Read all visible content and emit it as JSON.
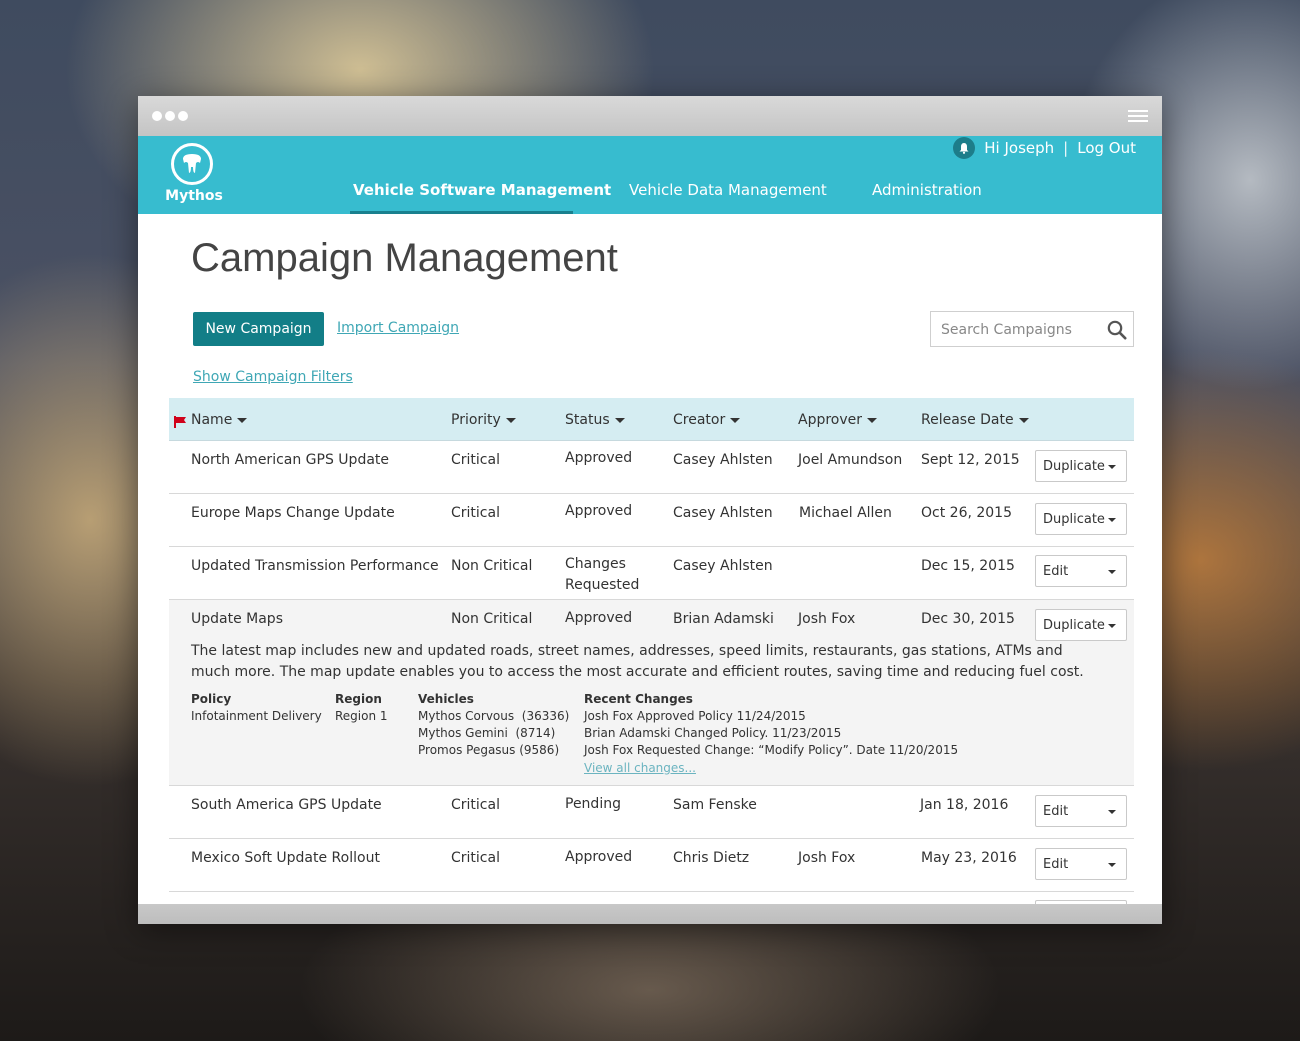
{
  "app": {
    "logo_text": "Mythos",
    "greeting": "Hi Joseph",
    "separator": "|",
    "logout": "Log Out"
  },
  "nav": [
    {
      "label": "Vehicle Software Management",
      "active": true
    },
    {
      "label": "Vehicle Data Management",
      "active": false
    },
    {
      "label": "Administration",
      "active": false
    }
  ],
  "page": {
    "title": "Campaign Management",
    "new_button": "New Campaign",
    "import_link": "Import Campaign",
    "filters_link": "Show Campaign Filters",
    "search_placeholder": "Search Campaigns"
  },
  "table": {
    "columns": [
      "Name",
      "Priority",
      "Status",
      "Creator",
      "Approver",
      "Release Date"
    ],
    "rows": [
      {
        "name": "North American GPS Update",
        "priority": "Critical",
        "status": "Approved",
        "creator": "Casey Ahlsten",
        "approver": "Joel Amundson",
        "date": "Sept 12, 2015",
        "action": "Duplicate"
      },
      {
        "name": "Europe Maps Change Update",
        "priority": "Critical",
        "status": "Approved",
        "creator": "Casey Ahlsten",
        "approver": "Michael Allen",
        "date": "Oct 26, 2015",
        "action": "Duplicate"
      },
      {
        "name": "Updated Transmission Performance",
        "priority": "Non Critical",
        "status": "Changes Requested",
        "creator": "Casey Ahlsten",
        "approver": "",
        "date": "Dec 15, 2015",
        "action": "Edit"
      },
      {
        "name": "Update Maps",
        "priority": "Non Critical",
        "status": "Approved",
        "creator": "Brian Adamski",
        "approver": "Josh Fox",
        "date": "Dec 30, 2015",
        "action": "Duplicate"
      },
      {
        "name": "South America GPS Update",
        "priority": "Critical",
        "status": "Pending",
        "creator": "Sam Fenske",
        "approver": "",
        "date": "Jan 18, 2016",
        "action": "Edit"
      },
      {
        "name": "Mexico Soft Update Rollout",
        "priority": "Critical",
        "status": "Approved",
        "creator": "Chris Dietz",
        "approver": "Josh Fox",
        "date": "May 23, 2016",
        "action": "Edit"
      }
    ]
  },
  "expanded": {
    "description": "The latest map includes new and updated roads, street names, addresses, speed limits, restaurants, gas stations, ATMs and much more. The map update enables you to access the most accurate and efficient routes, saving time and reducing fuel cost.",
    "policy_label": "Policy",
    "policy_value": "Infotainment Delivery",
    "region_label": "Region",
    "region_value": "Region 1",
    "vehicles_label": "Vehicles",
    "vehicles": [
      "Mythos Corvous  (36336)",
      "Mythos Gemini  (8714)",
      "Promos Pegasus (9586)"
    ],
    "changes_label": "Recent Changes",
    "changes": [
      "Josh Fox Approved Policy 11/24/2015",
      "Brian Adamski Changed Policy. 11/23/2015",
      "Josh Fox Requested Change: “Modify Policy”. Date 11/20/2015"
    ],
    "view_all": "View all changes..."
  },
  "colors": {
    "header": "#37bccf",
    "primary_button": "#127e87",
    "link": "#3fa7b5",
    "table_header": "#d5edf2",
    "flag": "#d0021b"
  }
}
